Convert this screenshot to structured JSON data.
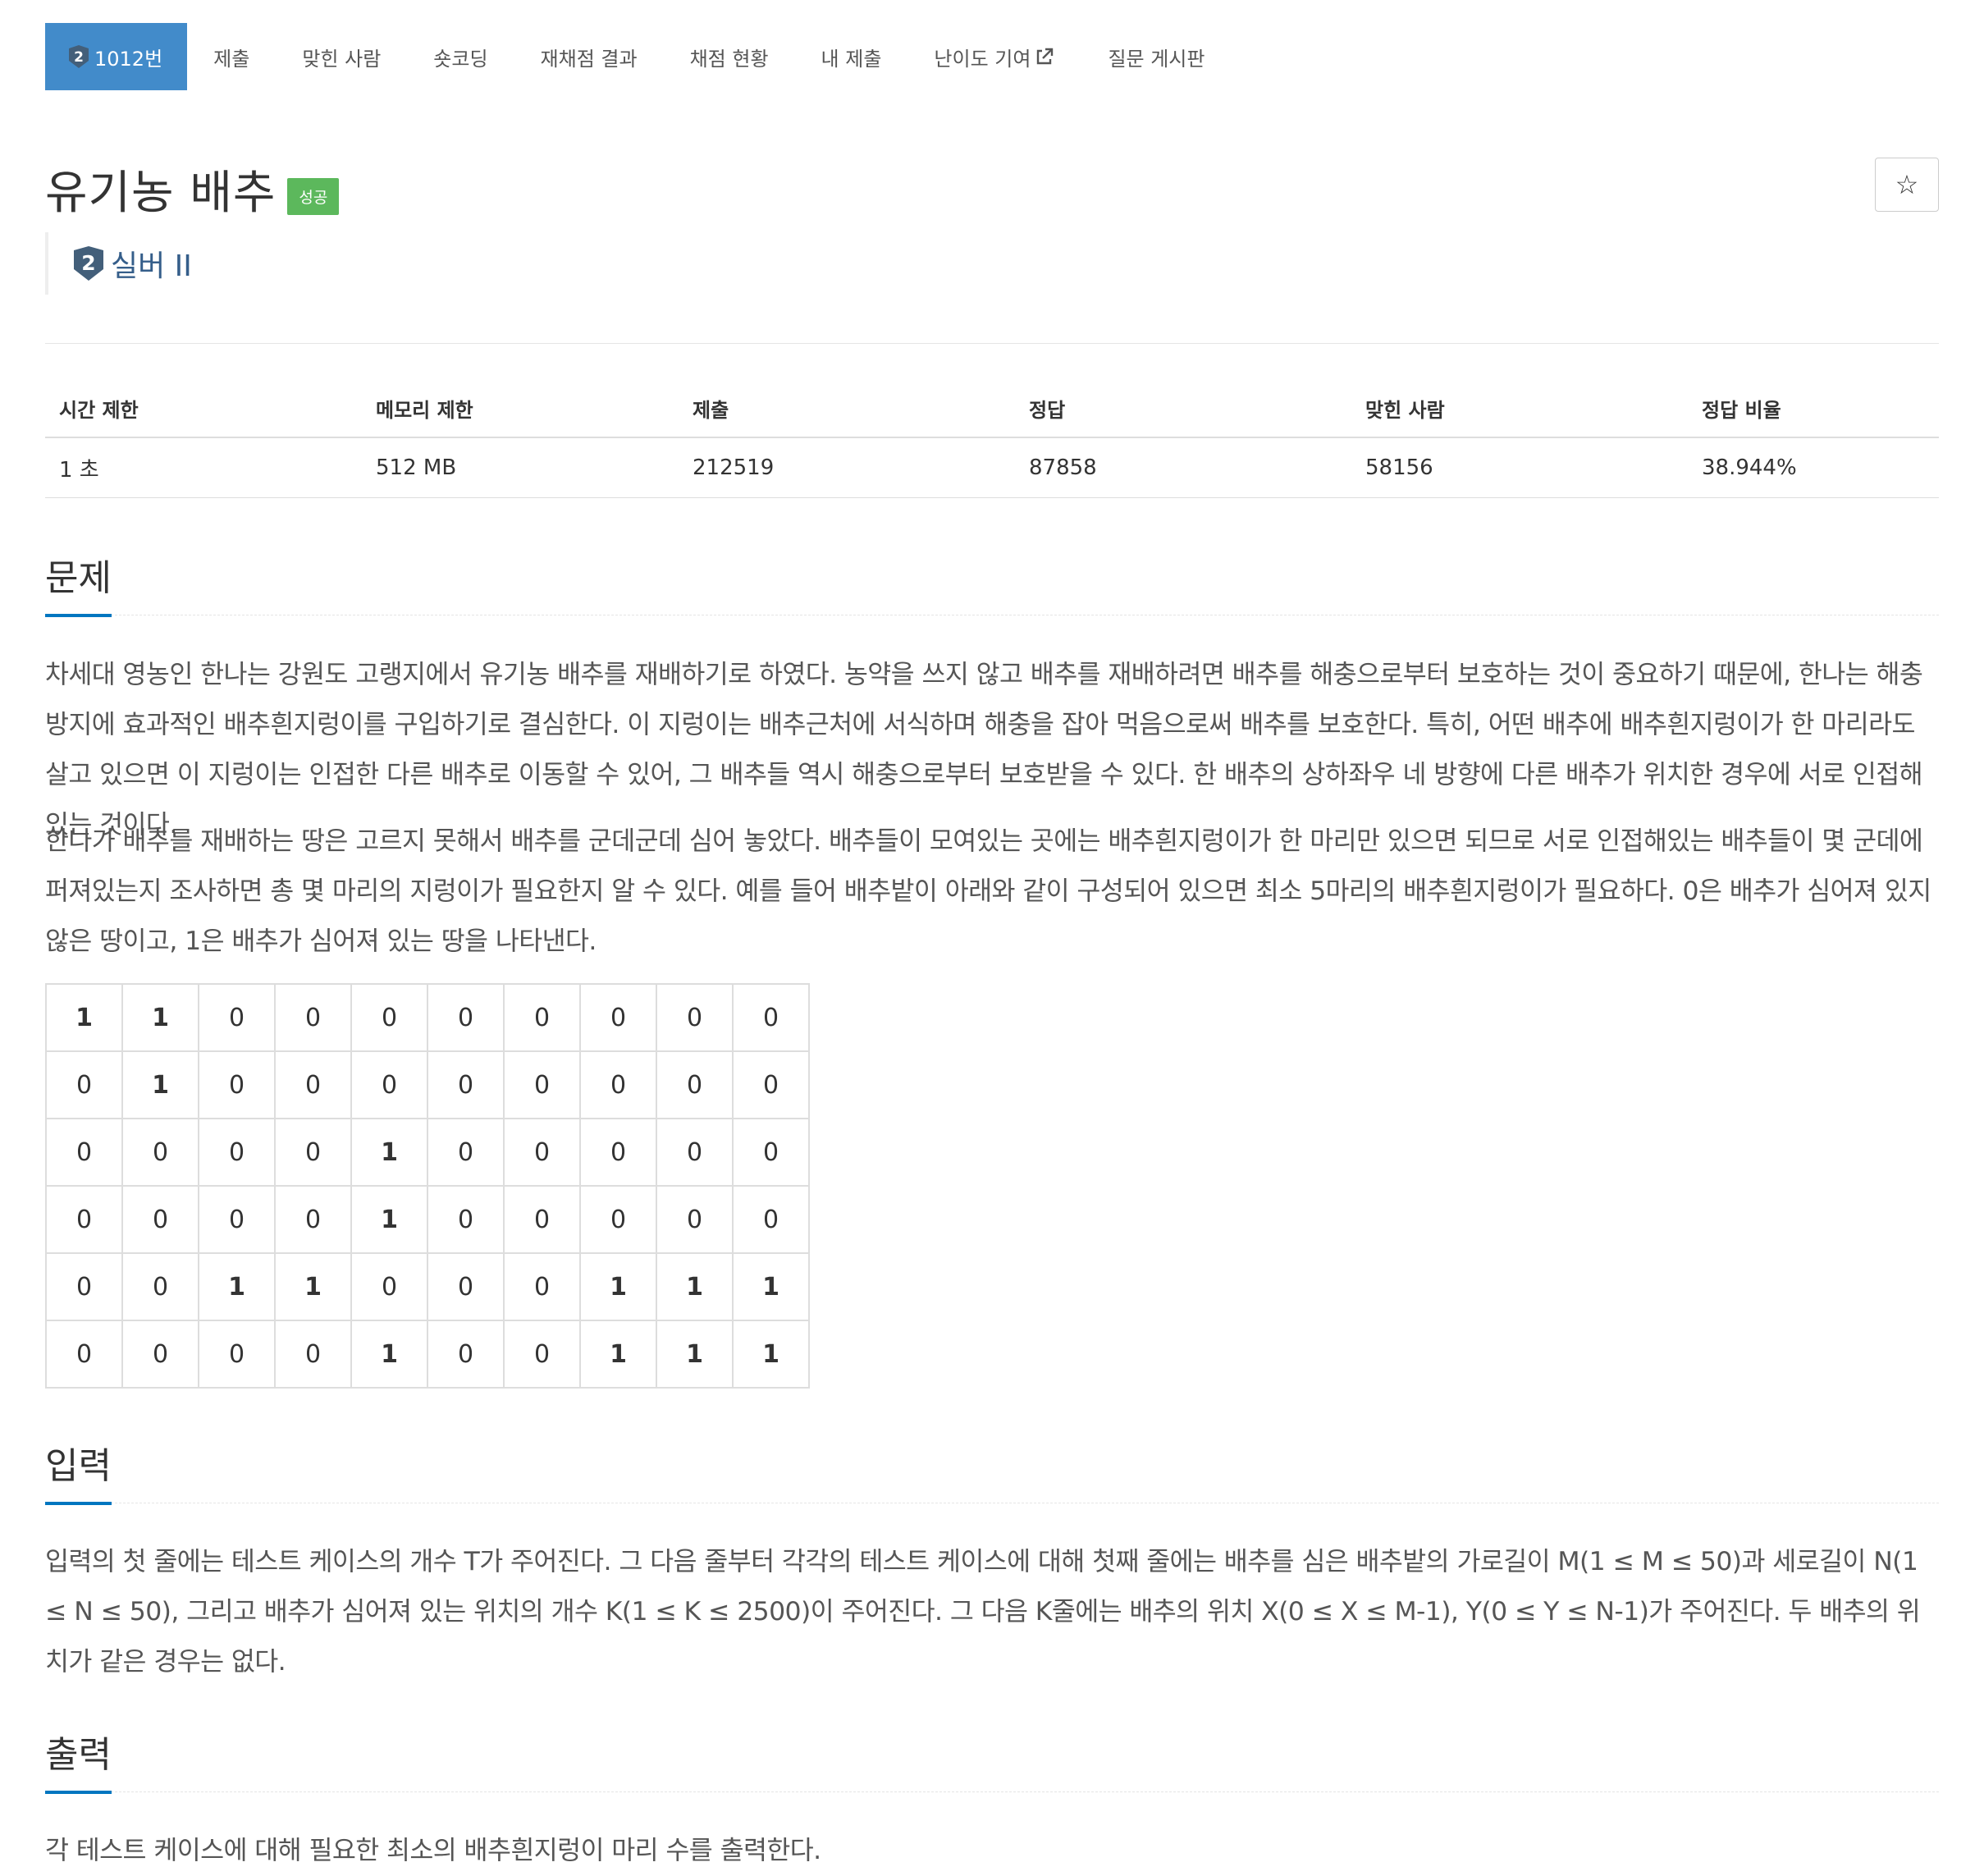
{
  "nav": {
    "items": [
      {
        "label": "1012번",
        "active": true,
        "icon": "silver-2-tier-icon"
      },
      {
        "label": "제출"
      },
      {
        "label": "맞힌 사람"
      },
      {
        "label": "숏코딩"
      },
      {
        "label": "재채점 결과"
      },
      {
        "label": "채점 현황"
      },
      {
        "label": "내 제출"
      },
      {
        "label": "난이도 기여",
        "icon": "external-link-icon"
      },
      {
        "label": "질문 게시판"
      }
    ]
  },
  "problem": {
    "title": "유기농 배추",
    "result_label": "성공",
    "star_icon": "☆",
    "tier": "실버 II",
    "tier_number": "2",
    "tier_color": "#435f7a"
  },
  "info": {
    "headers": [
      "시간 제한",
      "메모리 제한",
      "제출",
      "정답",
      "맞힌 사람",
      "정답 비율"
    ],
    "values": [
      "1 초",
      "512 MB",
      "212519",
      "87858",
      "58156",
      "38.944%"
    ]
  },
  "sections": {
    "description": {
      "title": "문제",
      "paragraphs": [
        "차세대 영농인 한나는 강원도 고랭지에서 유기농 배추를 재배하기로 하였다. 농약을 쓰지 않고 배추를 재배하려면 배추를 해충으로부터 보호하는 것이 중요하기 때문에, 한나는 해충 방지에 효과적인 배추흰지렁이를 구입하기로 결심한다. 이 지렁이는 배추근처에 서식하며 해충을 잡아 먹음으로써 배추를 보호한다. 특히, 어떤 배추에 배추흰지렁이가 한 마리라도 살고 있으면 이 지렁이는 인접한 다른 배추로 이동할 수 있어, 그 배추들 역시 해충으로부터 보호받을 수 있다. 한 배추의 상하좌우 네 방향에 다른 배추가 위치한 경우에 서로 인접해있는 것이다.",
        "한나가 배추를 재배하는 땅은 고르지 못해서 배추를 군데군데 심어 놓았다. 배추들이 모여있는 곳에는 배추흰지렁이가 한 마리만 있으면 되므로 서로 인접해있는 배추들이 몇 군데에 퍼져있는지 조사하면 총 몇 마리의 지렁이가 필요한지 알 수 있다. 예를 들어 배추밭이 아래와 같이 구성되어 있으면 최소 5마리의 배추흰지렁이가 필요하다. 0은 배추가 심어져 있지 않은 땅이고, 1은 배추가 심어져 있는 땅을 나타낸다."
      ],
      "grid": [
        [
          1,
          1,
          0,
          0,
          0,
          0,
          0,
          0,
          0,
          0
        ],
        [
          0,
          1,
          0,
          0,
          0,
          0,
          0,
          0,
          0,
          0
        ],
        [
          0,
          0,
          0,
          0,
          1,
          0,
          0,
          0,
          0,
          0
        ],
        [
          0,
          0,
          0,
          0,
          1,
          0,
          0,
          0,
          0,
          0
        ],
        [
          0,
          0,
          1,
          1,
          0,
          0,
          0,
          1,
          1,
          1
        ],
        [
          0,
          0,
          0,
          0,
          1,
          0,
          0,
          1,
          1,
          1
        ]
      ]
    },
    "input": {
      "title": "입력",
      "text": "입력의 첫 줄에는 테스트 케이스의 개수 T가 주어진다. 그 다음 줄부터 각각의 테스트 케이스에 대해 첫째 줄에는 배추를 심은 배추밭의 가로길이 M(1 ≤ M ≤ 50)과 세로길이 N(1 ≤ N ≤ 50), 그리고 배추가 심어져 있는 위치의 개수 K(1 ≤ K ≤ 2500)이 주어진다. 그 다음 K줄에는 배추의 위치 X(0 ≤ X ≤ M-1), Y(0 ≤ Y ≤ N-1)가 주어진다. 두 배추의 위치가 같은 경우는 없다."
    },
    "output": {
      "title": "출력",
      "text": "각 테스트 케이스에 대해 필요한 최소의 배추흰지렁이 마리 수를 출력한다."
    }
  },
  "colors": {
    "nav_active": "#428bca",
    "success": "#5cb85c",
    "section_underline": "#0076c0"
  }
}
